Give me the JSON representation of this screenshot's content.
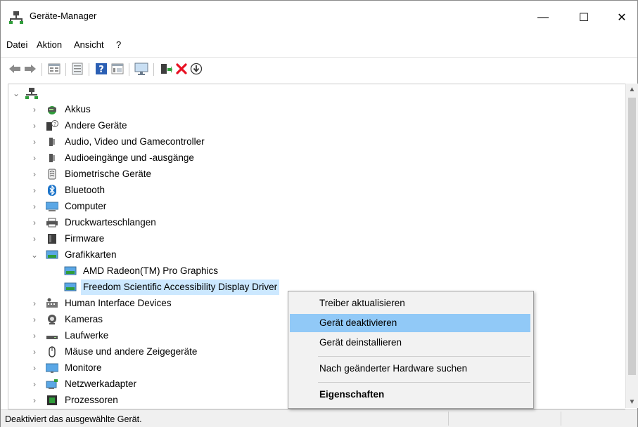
{
  "window": {
    "title": "Geräte-Manager",
    "min_glyph": "—",
    "max_glyph": "☐",
    "close_glyph": "✕"
  },
  "menu": {
    "items": [
      "Datei",
      "Aktion",
      "Ansicht",
      "?"
    ]
  },
  "toolbar": {
    "icons": [
      "back-icon",
      "forward-icon",
      "properties-grid-icon",
      "driver-icon",
      "help-icon",
      "view-icon",
      "monitor-icon",
      "add-driver-icon",
      "uninstall-icon",
      "download-icon"
    ]
  },
  "tree": {
    "root_icon": "computer-root-icon",
    "categories": [
      {
        "label": "Akkus",
        "icon": "battery-icon"
      },
      {
        "label": "Andere Geräte",
        "icon": "unknown-device-icon"
      },
      {
        "label": "Audio, Video und Gamecontroller",
        "icon": "speaker-icon"
      },
      {
        "label": "Audioeingänge und -ausgänge",
        "icon": "speaker-icon"
      },
      {
        "label": "Biometrische Geräte",
        "icon": "fingerprint-icon"
      },
      {
        "label": "Bluetooth",
        "icon": "bluetooth-icon"
      },
      {
        "label": "Computer",
        "icon": "computer-icon"
      },
      {
        "label": "Druckwarteschlangen",
        "icon": "printer-icon"
      },
      {
        "label": "Firmware",
        "icon": "firmware-icon"
      },
      {
        "label": "Grafikkarten",
        "icon": "display-adapter-icon"
      },
      {
        "label": "Human Interface Devices",
        "icon": "hid-icon"
      },
      {
        "label": "Kameras",
        "icon": "camera-icon"
      },
      {
        "label": "Laufwerke",
        "icon": "drive-icon"
      },
      {
        "label": "Mäuse und andere Zeigegeräte",
        "icon": "mouse-icon"
      },
      {
        "label": "Monitore",
        "icon": "monitor-icon"
      },
      {
        "label": "Netzwerkadapter",
        "icon": "network-icon"
      },
      {
        "label": "Prozessoren",
        "icon": "processor-icon"
      }
    ],
    "grafik_children": [
      {
        "label": "AMD Radeon(TM) Pro Graphics"
      },
      {
        "label": "Freedom Scientific Accessibility Display Driver"
      }
    ]
  },
  "context_menu": {
    "items": [
      {
        "label": "Treiber aktualisieren"
      },
      {
        "label": "Gerät deaktivieren"
      },
      {
        "label": "Gerät deinstallieren"
      },
      {
        "label": "Nach geänderter Hardware suchen"
      },
      {
        "label": "Eigenschaften"
      }
    ]
  },
  "status": {
    "text": "Deaktiviert das ausgewählte Gerät."
  },
  "colors": {
    "selection": "#cce8ff",
    "menu_highlight": "#91c9f7",
    "uninstall_red": "#e81123"
  }
}
